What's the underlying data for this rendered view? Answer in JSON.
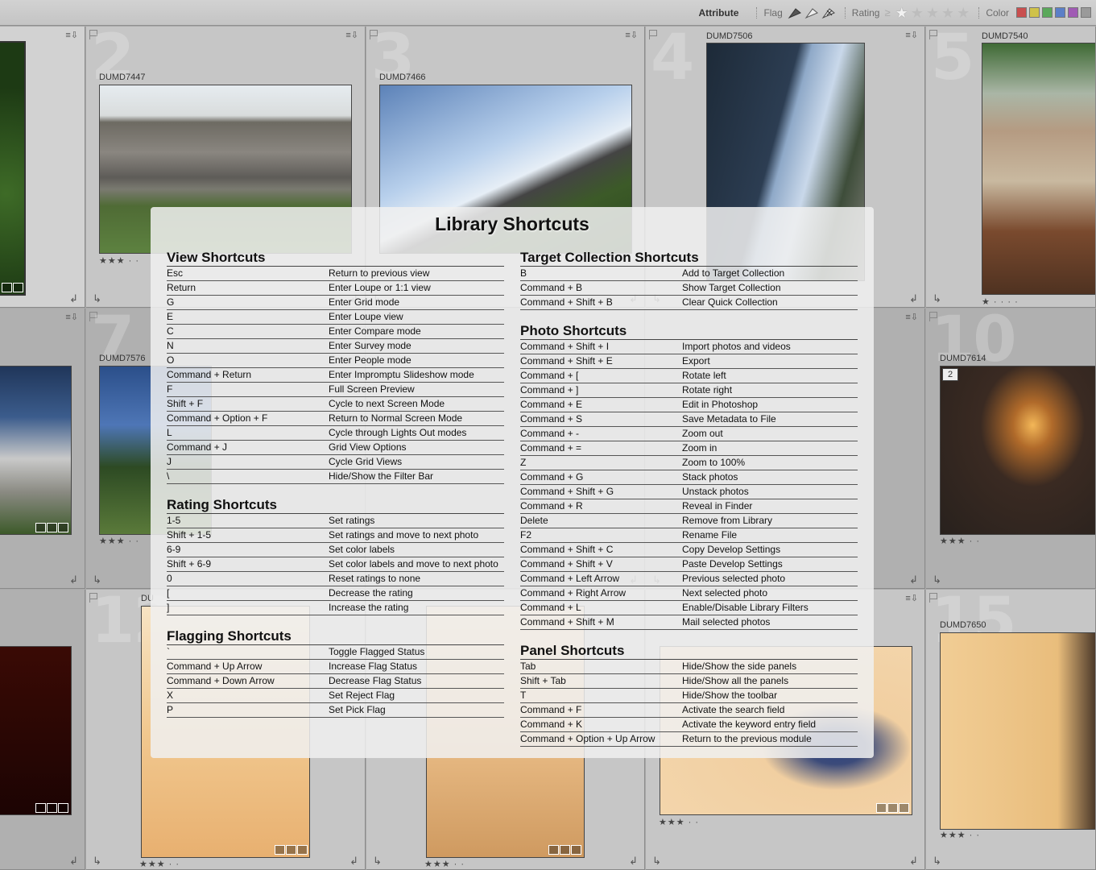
{
  "filter_bar": {
    "attribute_label": "Attribute",
    "flag_label": "Flag",
    "rating_label": "Rating",
    "rating_operator": "≥",
    "color_label": "Color",
    "color_swatches": [
      "#c94f4f",
      "#cfc24a",
      "#5aa85a",
      "#5b7fc7",
      "#a05bb4",
      "#9a9a9a"
    ]
  },
  "grid": {
    "cells": [
      {
        "num": "",
        "name": "",
        "rating": ""
      },
      {
        "num": "2",
        "name": "DUMD7447",
        "rating": "★★★ · ·"
      },
      {
        "num": "3",
        "name": "DUMD7466",
        "rating": ""
      },
      {
        "num": "4",
        "name": "DUMD7506",
        "rating": ""
      },
      {
        "num": "5",
        "name": "DUMD7540",
        "rating": "★ · · · ·"
      },
      {
        "num": "",
        "name": "",
        "rating": ""
      },
      {
        "num": "7",
        "name": "DUMD7576",
        "rating": "★★★ · ·"
      },
      {
        "num": "",
        "name": "",
        "rating": ""
      },
      {
        "num": "",
        "name": "",
        "rating": ""
      },
      {
        "num": "10",
        "name": "DUMD7614",
        "rating": "★★★ · ·",
        "virtual_copy": "2"
      },
      {
        "num": "",
        "name": "",
        "rating": ""
      },
      {
        "num": "12",
        "name": "DU",
        "rating": "★★★ · ·"
      },
      {
        "num": "",
        "name": "",
        "rating": "★★★ · ·"
      },
      {
        "num": "",
        "name": "",
        "rating": "★★★ · ·"
      },
      {
        "num": "15",
        "name": "DUMD7650",
        "rating": "★★★ · ·"
      }
    ]
  },
  "overlay": {
    "title": "Library Shortcuts",
    "sections_left": [
      {
        "title": "View Shortcuts",
        "rows": [
          [
            "Esc",
            "Return to previous view"
          ],
          [
            "Return",
            "Enter Loupe or 1:1 view"
          ],
          [
            "G",
            "Enter Grid mode"
          ],
          [
            "E",
            "Enter Loupe view"
          ],
          [
            "C",
            "Enter Compare mode"
          ],
          [
            "N",
            "Enter Survey mode"
          ],
          [
            "O",
            "Enter People mode"
          ],
          [
            "Command + Return",
            "Enter Impromptu Slideshow mode"
          ],
          [
            "F",
            "Full Screen Preview"
          ],
          [
            "Shift + F",
            "Cycle to next Screen Mode"
          ],
          [
            "Command + Option + F",
            "Return to Normal Screen Mode"
          ],
          [
            "L",
            "Cycle through Lights Out modes"
          ],
          [
            "Command + J",
            "Grid View Options"
          ],
          [
            "J",
            "Cycle Grid Views"
          ],
          [
            "\\",
            "Hide/Show the Filter Bar"
          ]
        ]
      },
      {
        "title": "Rating Shortcuts",
        "rows": [
          [
            "1-5",
            "Set ratings"
          ],
          [
            "Shift + 1-5",
            "Set ratings and move to next photo"
          ],
          [
            "6-9",
            "Set color labels"
          ],
          [
            "Shift + 6-9",
            "Set color labels and move to next photo"
          ],
          [
            "0",
            "Reset ratings to none"
          ],
          [
            "[",
            "Decrease the rating"
          ],
          [
            "]",
            "Increase the rating"
          ]
        ]
      },
      {
        "title": "Flagging Shortcuts",
        "rows": [
          [
            "`",
            "Toggle Flagged Status"
          ],
          [
            "Command + Up Arrow",
            "Increase Flag Status"
          ],
          [
            "Command + Down Arrow",
            "Decrease Flag Status"
          ],
          [
            "X",
            "Set Reject Flag"
          ],
          [
            "P",
            "Set Pick Flag"
          ]
        ]
      }
    ],
    "sections_right": [
      {
        "title": "Target Collection Shortcuts",
        "rows": [
          [
            "B",
            "Add to Target Collection"
          ],
          [
            "Command + B",
            "Show Target Collection"
          ],
          [
            "Command + Shift + B",
            "Clear Quick Collection"
          ]
        ]
      },
      {
        "title": "Photo Shortcuts",
        "rows": [
          [
            "Command + Shift + I",
            "Import photos and videos"
          ],
          [
            "Command + Shift + E",
            "Export"
          ],
          [
            "Command + [",
            "Rotate left"
          ],
          [
            "Command + ]",
            "Rotate right"
          ],
          [
            "Command + E",
            "Edit in Photoshop"
          ],
          [
            "Command + S",
            "Save Metadata to File"
          ],
          [
            "Command + -",
            "Zoom out"
          ],
          [
            "Command + =",
            "Zoom in"
          ],
          [
            "Z",
            "Zoom to 100%"
          ],
          [
            "Command + G",
            "Stack photos"
          ],
          [
            "Command + Shift + G",
            "Unstack photos"
          ],
          [
            "Command + R",
            "Reveal in Finder"
          ],
          [
            "Delete",
            "Remove from Library"
          ],
          [
            "F2",
            "Rename File"
          ],
          [
            "Command + Shift + C",
            "Copy Develop Settings"
          ],
          [
            "Command + Shift + V",
            "Paste Develop Settings"
          ],
          [
            "Command + Left Arrow",
            "Previous selected photo"
          ],
          [
            "Command + Right Arrow",
            "Next selected photo"
          ],
          [
            "Command + L",
            "Enable/Disable Library Filters"
          ],
          [
            "Command + Shift + M",
            "Mail selected photos"
          ]
        ]
      },
      {
        "title": "Panel Shortcuts",
        "rows": [
          [
            "Tab",
            "Hide/Show the side panels"
          ],
          [
            "Shift + Tab",
            "Hide/Show all the panels"
          ],
          [
            "T",
            "Hide/Show the toolbar"
          ],
          [
            "Command + F",
            "Activate the search field"
          ],
          [
            "Command + K",
            "Activate the keyword entry field"
          ],
          [
            "Command + Option + Up Arrow",
            "Return to the previous module"
          ]
        ]
      }
    ]
  }
}
